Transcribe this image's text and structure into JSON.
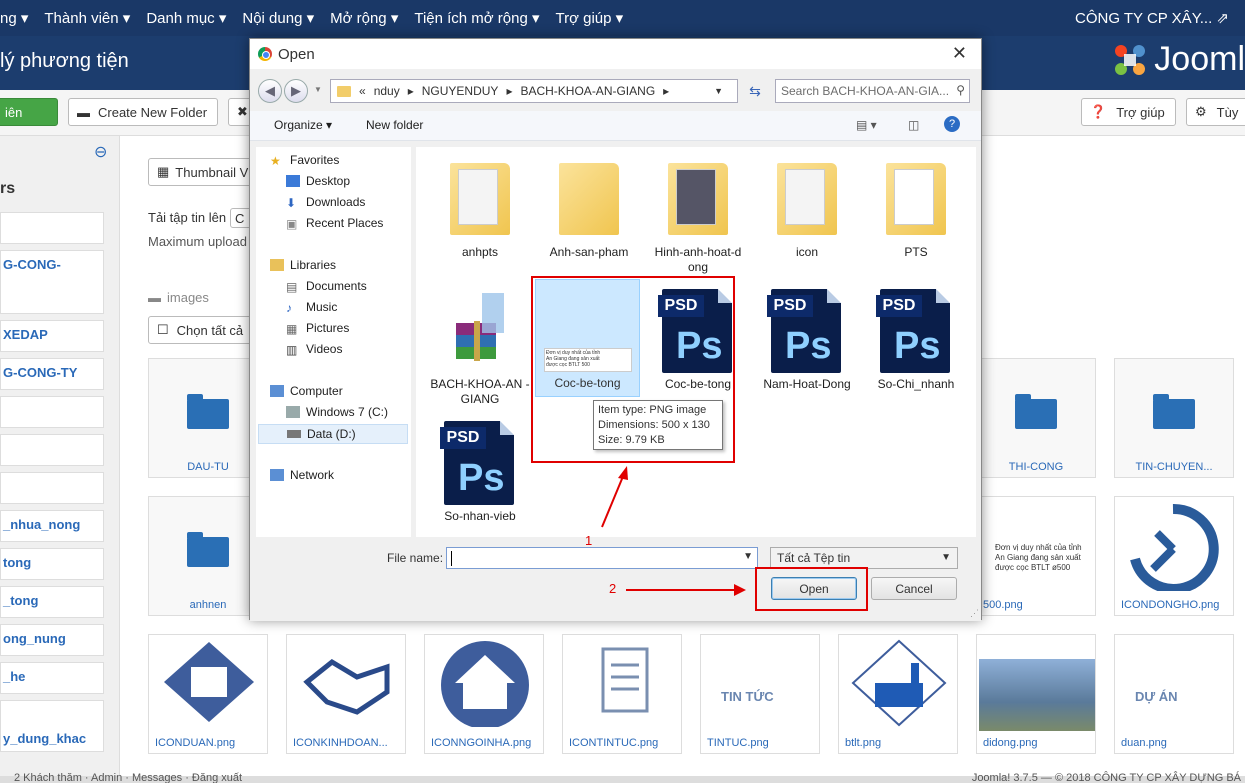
{
  "topnav": {
    "items": [
      "ng ▾",
      "Thành viên ▾",
      "Danh mục ▾",
      "Nội dung ▾",
      "Mở rộng ▾",
      "Tiện ích mở rộng ▾",
      "Trợ giúp ▾"
    ],
    "company": "CÔNG TY CP XÂY... ⇗"
  },
  "header": {
    "title": "lý phương tiện",
    "logo_text": "Jooml"
  },
  "toolbar": {
    "upload_label": "iên",
    "create_folder_label": "Create New Folder",
    "help_label": "Trợ giúp",
    "options_label": "Tùy"
  },
  "sidebar": {
    "title": "rs",
    "items": [
      "",
      "G-CONG-",
      "XEDAP",
      "G-CONG-TY",
      "",
      "",
      "",
      "_nhua_nong",
      "tong",
      "_tong",
      "ong_nung",
      "_he",
      "y_dung_khac"
    ]
  },
  "main": {
    "view_label": "Thumbnail V",
    "upload_label": "Tải tập tin lên",
    "upload_btn": "C",
    "max_upload": "Maximum upload",
    "breadcrumb": "images",
    "select_all": "Chọn tất cả",
    "row1": [
      "DAU-TU",
      "THI-CONG",
      "TIN-CHUYEN..."
    ],
    "row2": [
      "anhnen",
      "500.png",
      "ICONDONGHO.png"
    ],
    "row2_thumb_text": [
      "Đơn vị duy nhất của tỉnh",
      "An Giang đang sản xuất",
      "được cọc BTLT ø500"
    ],
    "row3": [
      "ICONDUAN.png",
      "ICONKINHDOAN...",
      "ICONNGOINHA.png",
      "ICONTINTUC.png",
      "TINTUC.png",
      "btlt.png",
      "didong.png",
      "duan.png"
    ],
    "row3_thumb_text": [
      "TIN TỨC",
      "DỰ ÁN"
    ]
  },
  "dialog": {
    "title": "Open",
    "address": [
      "«",
      "nduy",
      "▸",
      "NGUYENDUY",
      "▸",
      "BACH-KHOA-AN-GIANG",
      "▸"
    ],
    "search_placeholder": "Search BACH-KHOA-AN-GIA...",
    "organize": "Organize ▾",
    "new_folder": "New folder",
    "nav": {
      "favorites": "Favorites",
      "desktop": "Desktop",
      "downloads": "Downloads",
      "recent": "Recent Places",
      "libraries": "Libraries",
      "documents": "Documents",
      "music": "Music",
      "pictures": "Pictures",
      "videos": "Videos",
      "computer": "Computer",
      "c_drive": "Windows 7 (C:)",
      "d_drive": "Data (D:)",
      "network": "Network"
    },
    "files": {
      "anhpts": "anhpts",
      "anh_san_pham": "Anh-san-pham",
      "hinh_anh": "Hinh-anh-hoat-d ong",
      "icon": "icon",
      "pts": "PTS",
      "bach_khoa": "BACH-KHOA-AN -GIANG",
      "coc_png": "Coc-be-tong",
      "coc_psd": "Coc-be-tong",
      "nam_hoat": "Nam-Hoat-Dong",
      "so_chi": "So-Chi_nhanh",
      "so_nhan": "So-nhan-vieb",
      "psd_tag": "PSD",
      "ps": "Ps"
    },
    "tooltip": {
      "type": "Item type: PNG image",
      "dims": "Dimensions: 500 x 130",
      "size": "Size: 9.79 KB"
    },
    "filename_label": "File name:",
    "filename_value": "",
    "filetype": "Tất cả Tệp tin",
    "open_btn": "Open",
    "cancel_btn": "Cancel"
  },
  "annotations": {
    "one": "1",
    "two": "2"
  },
  "footer": {
    "left": "2 Khách thăm · Admin · Messages · Đăng xuất",
    "right": "Joomla! 3.7.5 — © 2018 CÔNG TY CP XÂY DỰNG BÁ"
  },
  "colors": {
    "nav": "#1a3867",
    "header": "#1c3d6e",
    "annotation": "#e00000",
    "selection": "#cce8ff"
  }
}
